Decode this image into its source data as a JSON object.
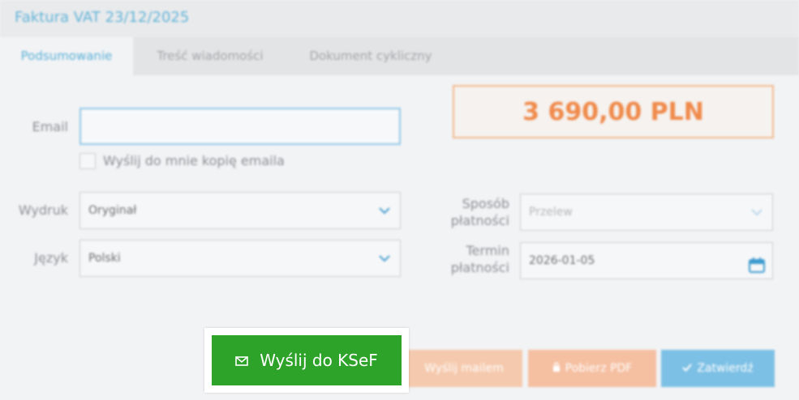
{
  "window": {
    "title": "Faktura VAT 23/12/2025"
  },
  "tabs": [
    {
      "label": "Podsumowanie",
      "active": true
    },
    {
      "label": "Treść wiadomości",
      "active": false
    },
    {
      "label": "Dokument cykliczny",
      "active": false
    }
  ],
  "form": {
    "email_label": "Email",
    "email_value": "",
    "copy_checkbox_label": "Wyślij do mnie kopię emaila",
    "copy_checked": false,
    "wydruk_label": "Wydruk",
    "wydruk_value": "Oryginał",
    "jezyk_label": "Język",
    "jezyk_value": "Polski",
    "sposob_label_line1": "Sposób",
    "sposob_label_line2": "płatności",
    "sposob_value": "Przelew",
    "termin_label_line1": "Termin",
    "termin_label_line2": "płatności",
    "termin_value": "2026-01-05"
  },
  "summary": {
    "amount": "3 690,00 PLN"
  },
  "actions": {
    "ksef_label": "Wyślij do KSeF",
    "mail_label": "Wyślij mailem",
    "pdf_label": "Pobierz PDF",
    "confirm_label": "Zatwierdź"
  },
  "colors": {
    "accent_blue": "#5ab0d6",
    "amount_orange": "#f08a4b",
    "ksef_green": "#2ea32a"
  },
  "icons": {
    "ksef": "envelope-icon",
    "mail": "envelope-icon",
    "pdf": "lock-icon",
    "confirm": "checkmark-icon",
    "date": "calendar-icon",
    "select": "chevron-down-icon"
  }
}
